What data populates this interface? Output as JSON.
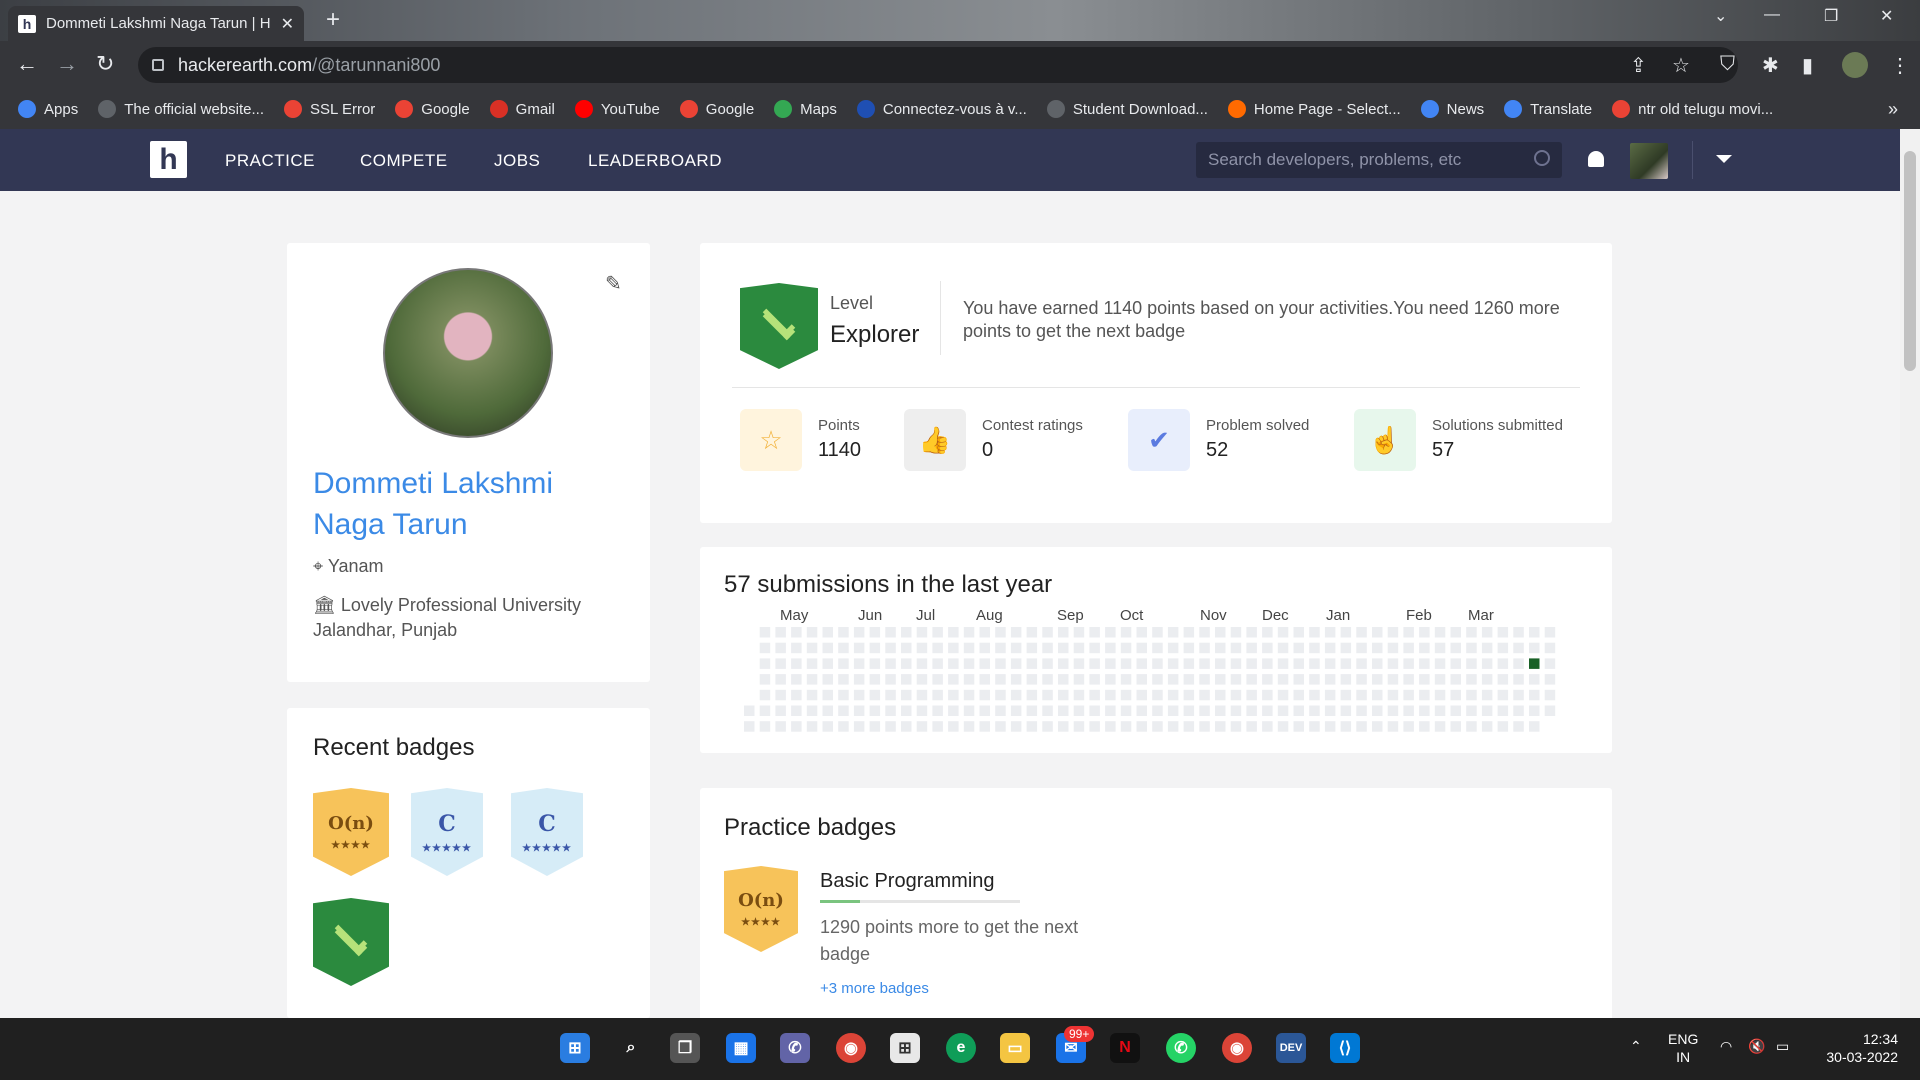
{
  "browser": {
    "tab_title": "Dommeti Lakshmi Naga Tarun | H",
    "url_host": "hackerearth.com",
    "url_path": "/@tarunnani800",
    "new_tab": "+"
  },
  "bookmarks": [
    {
      "label": "Apps",
      "color": "#4285f4",
      "icon": "apps-grid-icon"
    },
    {
      "label": "The official website...",
      "color": "#5f6368",
      "icon": "globe-icon"
    },
    {
      "label": "SSL Error",
      "color": "#ea4335",
      "icon": "google-icon"
    },
    {
      "label": "Google",
      "color": "#ea4335",
      "icon": "google-icon"
    },
    {
      "label": "Gmail",
      "color": "#d93025",
      "icon": "gmail-icon"
    },
    {
      "label": "YouTube",
      "color": "#ff0000",
      "icon": "youtube-icon"
    },
    {
      "label": "Google",
      "color": "#ea4335",
      "icon": "google-icon"
    },
    {
      "label": "Maps",
      "color": "#34a853",
      "icon": "maps-icon"
    },
    {
      "label": "Connectez-vous à v...",
      "color": "#1f4fb3",
      "icon": "paypal-icon"
    },
    {
      "label": "Student Download...",
      "color": "#5f6368",
      "icon": "globe-icon"
    },
    {
      "label": "Home Page - Select...",
      "color": "#ff6a00",
      "icon": "selection-icon"
    },
    {
      "label": "News",
      "color": "#4285f4",
      "icon": "news-icon"
    },
    {
      "label": "Translate",
      "color": "#4285f4",
      "icon": "translate-icon"
    },
    {
      "label": "ntr old telugu movi...",
      "color": "#ea4335",
      "icon": "google-icon"
    }
  ],
  "bookmarks_more": "»",
  "nav": {
    "links": [
      "PRACTICE",
      "COMPETE",
      "JOBS",
      "LEADERBOARD"
    ],
    "logo": "h",
    "search_placeholder": "Search developers, problems, etc"
  },
  "profile": {
    "name": "Dommeti Lakshmi Naga Tarun",
    "location": "Yanam",
    "university": "Lovely Professional University",
    "city": "Jalandhar, Punjab"
  },
  "recent_badges": {
    "title": "Recent badges",
    "items": [
      {
        "label": "O(n)",
        "stars": "★★★★",
        "style": "orange"
      },
      {
        "label": "C",
        "stars": "★★★★★",
        "style": "blue"
      },
      {
        "label": "C",
        "stars": "★★★★★",
        "style": "blue"
      },
      {
        "label": "",
        "stars": "",
        "style": "green"
      }
    ]
  },
  "level": {
    "label": "Level",
    "name": "Explorer",
    "message": "You have earned 1140 points based on your activities.You need 1260 more points to get the next badge"
  },
  "stats": [
    {
      "label": "Points",
      "value": "1140",
      "icon": "star-icon",
      "bg": "#fff4dd",
      "color": "#f2b33d"
    },
    {
      "label": "Contest ratings",
      "value": "0",
      "icon": "thumbs-up-icon",
      "bg": "#eeeeee",
      "color": "#888888"
    },
    {
      "label": "Problem solved",
      "value": "52",
      "icon": "check-badge-icon",
      "bg": "#e8eefc",
      "color": "#5b7be0"
    },
    {
      "label": "Solutions submitted",
      "value": "57",
      "icon": "hand-pointer-icon",
      "bg": "#e7f7ec",
      "color": "#3cb371"
    }
  ],
  "submissions": {
    "title": "57 submissions in the last year",
    "months": [
      "May",
      "Jun",
      "Jul",
      "Aug",
      "Sep",
      "Oct",
      "Nov",
      "Dec",
      "Jan",
      "Feb",
      "Mar"
    ],
    "active_color": "#196127",
    "empty_color": "#ebedf0"
  },
  "practice": {
    "title": "Practice badges",
    "badge_label": "O(n)",
    "badge_stars": "★★★★",
    "name": "Basic Programming",
    "progress": 0.2,
    "message": "1290 points more to get the next badge",
    "more_link": "+3 more badges"
  },
  "taskbar": {
    "lang": "ENG",
    "region": "IN",
    "time": "12:34",
    "date": "30-03-2022",
    "mail_badge": "99+"
  }
}
